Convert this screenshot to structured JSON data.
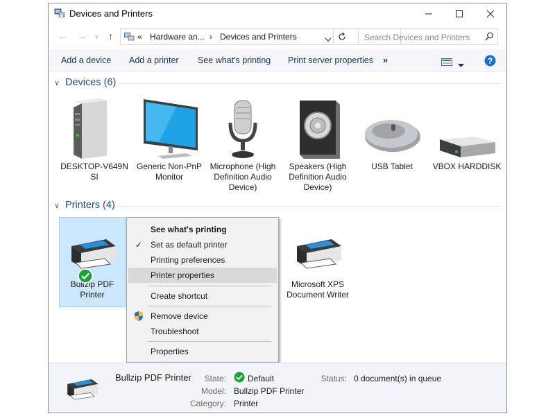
{
  "window": {
    "title": "Devices and Printers",
    "controls": {
      "minimize": "—",
      "maximize": "☐",
      "close": "✕"
    }
  },
  "address": {
    "crumbs": [
      "«",
      "Hardware an...",
      "›",
      "Devices and Printers"
    ],
    "search_placeholder": "Search Devices and Printers"
  },
  "commands": [
    "Add a device",
    "Add a printer",
    "See what's printing",
    "Print server properties",
    "»"
  ],
  "groups": {
    "devices": {
      "header": "Devices (6)",
      "items": [
        {
          "label": "DESKTOP-V649N SI",
          "icon": "computer-tower-icon"
        },
        {
          "label": "Generic Non-PnP Monitor",
          "icon": "monitor-icon"
        },
        {
          "label": "Microphone (High Definition Audio Device)",
          "icon": "microphone-icon"
        },
        {
          "label": "Speakers (High Definition Audio Device)",
          "icon": "speaker-icon"
        },
        {
          "label": "USB Tablet",
          "icon": "mouse-icon"
        },
        {
          "label": "VBOX HARDDISK",
          "icon": "harddisk-icon"
        }
      ]
    },
    "printers": {
      "header": "Printers (4)",
      "items": [
        {
          "label": "Bullzip PDF Printer",
          "icon": "printer-icon",
          "selected": true,
          "default": true
        },
        {
          "label": "Microsoft XPS Document Writer",
          "icon": "printer-icon"
        }
      ]
    }
  },
  "context_menu": {
    "items": [
      {
        "label": "See what's printing",
        "bold": true
      },
      {
        "label": "Set as default printer",
        "checked": true
      },
      {
        "label": "Printing preferences"
      },
      {
        "label": "Printer properties",
        "highlighted": true
      },
      {
        "label": "Create shortcut"
      },
      {
        "label": "Remove device",
        "icon": "uac-shield-icon"
      },
      {
        "label": "Troubleshoot"
      },
      {
        "label": "Properties"
      }
    ]
  },
  "details": {
    "name": "Bullzip PDF Printer",
    "state_label": "State:",
    "state_value": "Default",
    "status_label": "Status:",
    "status_value": "0 document(s) in queue",
    "model_label": "Model:",
    "model_value": "Bullzip PDF Printer",
    "category_label": "Category:",
    "category_value": "Printer"
  },
  "colors": {
    "accent": "#1e4e8c",
    "selection": "#cce8ff",
    "default_check": "#1f9e3b",
    "help": "#1a73c8"
  }
}
